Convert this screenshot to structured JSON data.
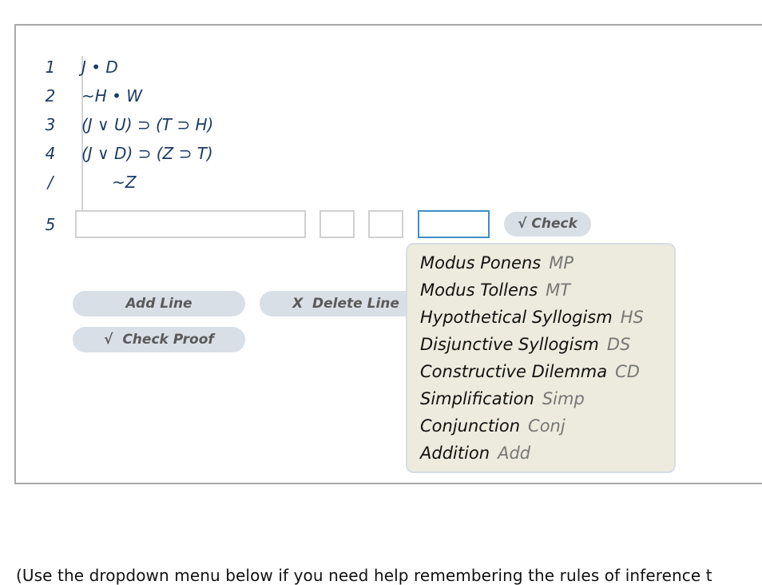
{
  "proof": {
    "premises": [
      {
        "num": "1",
        "formula": "J • D"
      },
      {
        "num": "2",
        "formula": "~H • W"
      },
      {
        "num": "3",
        "formula": "(J ∨ U) ⊃ (T ⊃ H)"
      },
      {
        "num": "4",
        "formula": "(J ∨ D) ⊃ (Z ⊃ T)"
      }
    ],
    "conclusion": {
      "num": "/",
      "formula": "~Z"
    },
    "new_line": {
      "num": "5",
      "formula_value": "",
      "ref1_value": "",
      "ref2_value": "",
      "rule_value": ""
    }
  },
  "buttons": {
    "check": "√ Check",
    "add_line": "Add Line",
    "delete_line": "X  Delete Line",
    "check_proof": "√  Check Proof"
  },
  "rules_dropdown": [
    {
      "name": "Modus Ponens",
      "abbr": "MP"
    },
    {
      "name": "Modus Tollens",
      "abbr": "MT"
    },
    {
      "name": "Hypothetical Syllogism",
      "abbr": "HS"
    },
    {
      "name": "Disjunctive Syllogism",
      "abbr": "DS"
    },
    {
      "name": "Constructive Dilemma",
      "abbr": "CD"
    },
    {
      "name": "Simplification",
      "abbr": "Simp"
    },
    {
      "name": "Conjunction",
      "abbr": "Conj"
    },
    {
      "name": "Addition",
      "abbr": "Add"
    }
  ],
  "hint_text": "(Use the dropdown menu below if you need help remembering the rules of inference t"
}
